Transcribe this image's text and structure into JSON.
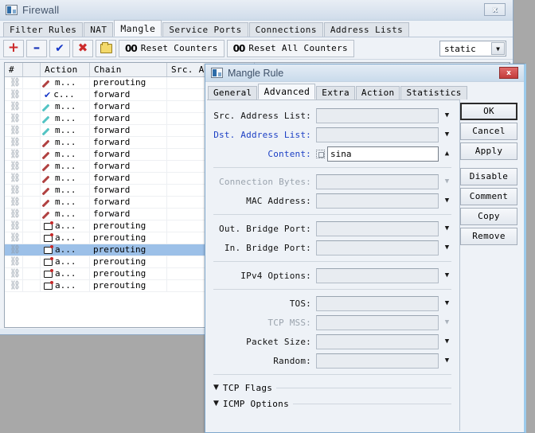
{
  "firewall": {
    "title": "Firewall",
    "window_icon": "window-icon",
    "close_label": "x",
    "tabs": [
      {
        "label": "Filter Rules",
        "active": false
      },
      {
        "label": "NAT",
        "active": false
      },
      {
        "label": "Mangle",
        "active": true
      },
      {
        "label": "Service Ports",
        "active": false
      },
      {
        "label": "Connections",
        "active": false
      },
      {
        "label": "Address Lists",
        "active": false
      }
    ],
    "toolbar": {
      "add_label": "+",
      "remove_label": "–",
      "enable_label": "✔",
      "disable_label": "✖",
      "comment_label": "folder-icon",
      "reset_counters_label": "Reset Counters",
      "reset_all_counters_label": "Reset All Counters",
      "counter_icon_label": "00"
    },
    "filter_select": {
      "value": "static",
      "arrow": "▼"
    },
    "table": {
      "columns": [
        "#",
        "",
        "Action",
        "Chain",
        "Src. Address",
        ""
      ],
      "rows": [
        {
          "num": "",
          "icon": "pencil-red",
          "action": "m...",
          "chain": "prerouting",
          "src": "",
          "selected": false
        },
        {
          "num": "",
          "icon": "check-blue",
          "action": "c...",
          "chain": "forward",
          "src": "",
          "selected": false
        },
        {
          "num": "",
          "icon": "pencil-teal",
          "action": "m...",
          "chain": "forward",
          "src": "",
          "selected": false
        },
        {
          "num": "",
          "icon": "pencil-teal",
          "action": "m...",
          "chain": "forward",
          "src": "",
          "selected": false
        },
        {
          "num": "",
          "icon": "pencil-teal",
          "action": "m...",
          "chain": "forward",
          "src": "",
          "selected": false
        },
        {
          "num": "",
          "icon": "pencil-red",
          "action": "m...",
          "chain": "forward",
          "src": "",
          "selected": false
        },
        {
          "num": "",
          "icon": "pencil-red",
          "action": "m...",
          "chain": "forward",
          "src": "",
          "selected": false
        },
        {
          "num": "",
          "icon": "pencil-red",
          "action": "m...",
          "chain": "forward",
          "src": "",
          "selected": false
        },
        {
          "num": "",
          "icon": "pencil-red",
          "action": "m...",
          "chain": "forward",
          "src": "",
          "selected": false
        },
        {
          "num": "",
          "icon": "pencil-red",
          "action": "m...",
          "chain": "forward",
          "src": "",
          "selected": false
        },
        {
          "num": "",
          "icon": "pencil-red",
          "action": "m...",
          "chain": "forward",
          "src": "",
          "selected": false
        },
        {
          "num": "",
          "icon": "pencil-red",
          "action": "m...",
          "chain": "forward",
          "src": "",
          "selected": false
        },
        {
          "num": "",
          "icon": "mark",
          "action": "a...",
          "chain": "prerouting",
          "src": "",
          "selected": false
        },
        {
          "num": "",
          "icon": "mark",
          "action": "a...",
          "chain": "prerouting",
          "src": "",
          "selected": false
        },
        {
          "num": "",
          "icon": "mark",
          "action": "a...",
          "chain": "prerouting",
          "src": "",
          "selected": true
        },
        {
          "num": "",
          "icon": "mark",
          "action": "a...",
          "chain": "prerouting",
          "src": "",
          "selected": false
        },
        {
          "num": "",
          "icon": "mark",
          "action": "a...",
          "chain": "prerouting",
          "src": "",
          "selected": false
        },
        {
          "num": "",
          "icon": "mark",
          "action": "a...",
          "chain": "prerouting",
          "src": "",
          "selected": false
        }
      ]
    }
  },
  "dialog": {
    "title": "Mangle Rule",
    "close_label": "x",
    "tabs": [
      {
        "label": "General",
        "active": false
      },
      {
        "label": "Advanced",
        "active": true
      },
      {
        "label": "Extra",
        "active": false
      },
      {
        "label": "Action",
        "active": false
      },
      {
        "label": "Statistics",
        "active": false
      }
    ],
    "fields": [
      {
        "label": "Src. Address List:",
        "value": "",
        "state": "normal",
        "control": "dropdown",
        "arrow": "▼"
      },
      {
        "label": "Dst. Address List:",
        "value": "",
        "state": "blue",
        "control": "dropdown",
        "arrow": "▼"
      },
      {
        "label": "Content:",
        "value": "sina",
        "state": "blue",
        "control": "text-checkbox",
        "arrow": "▲"
      },
      {
        "label": "Connection Bytes:",
        "value": "",
        "state": "disabled",
        "control": "dropdown",
        "arrow": "▼"
      },
      {
        "label": "MAC Address:",
        "value": "",
        "state": "normal",
        "control": "dropdown",
        "arrow": "▼"
      },
      {
        "label": "Out. Bridge Port:",
        "value": "",
        "state": "normal",
        "control": "dropdown",
        "arrow": "▼"
      },
      {
        "label": "In. Bridge Port:",
        "value": "",
        "state": "normal",
        "control": "dropdown",
        "arrow": "▼"
      },
      {
        "label": "IPv4 Options:",
        "value": "",
        "state": "normal",
        "control": "dropdown",
        "arrow": "▼"
      },
      {
        "label": "TOS:",
        "value": "",
        "state": "normal",
        "control": "dropdown",
        "arrow": "▼"
      },
      {
        "label": "TCP MSS:",
        "value": "",
        "state": "disabled",
        "control": "dropdown",
        "arrow": "▼"
      },
      {
        "label": "Packet Size:",
        "value": "",
        "state": "normal",
        "control": "dropdown",
        "arrow": "▼"
      },
      {
        "label": "Random:",
        "value": "",
        "state": "normal",
        "control": "dropdown",
        "arrow": "▼"
      }
    ],
    "collapsibles": [
      {
        "label": "TCP Flags",
        "arrow": "▼"
      },
      {
        "label": "ICMP Options",
        "arrow": "▼"
      }
    ],
    "buttons": [
      {
        "label": "OK",
        "primary": true,
        "gap": false
      },
      {
        "label": "Cancel",
        "primary": false,
        "gap": false
      },
      {
        "label": "Apply",
        "primary": false,
        "gap": false
      },
      {
        "label": "Disable",
        "primary": false,
        "gap": true
      },
      {
        "label": "Comment",
        "primary": false,
        "gap": false
      },
      {
        "label": "Copy",
        "primary": false,
        "gap": false
      },
      {
        "label": "Remove",
        "primary": false,
        "gap": false
      }
    ]
  },
  "colors": {
    "accent_blue": "#1b3fc4",
    "selection": "#9cc0e8",
    "window_bg": "#eef2f7",
    "desktop": "#a8a8a8",
    "close_red": "#c33c3c"
  }
}
